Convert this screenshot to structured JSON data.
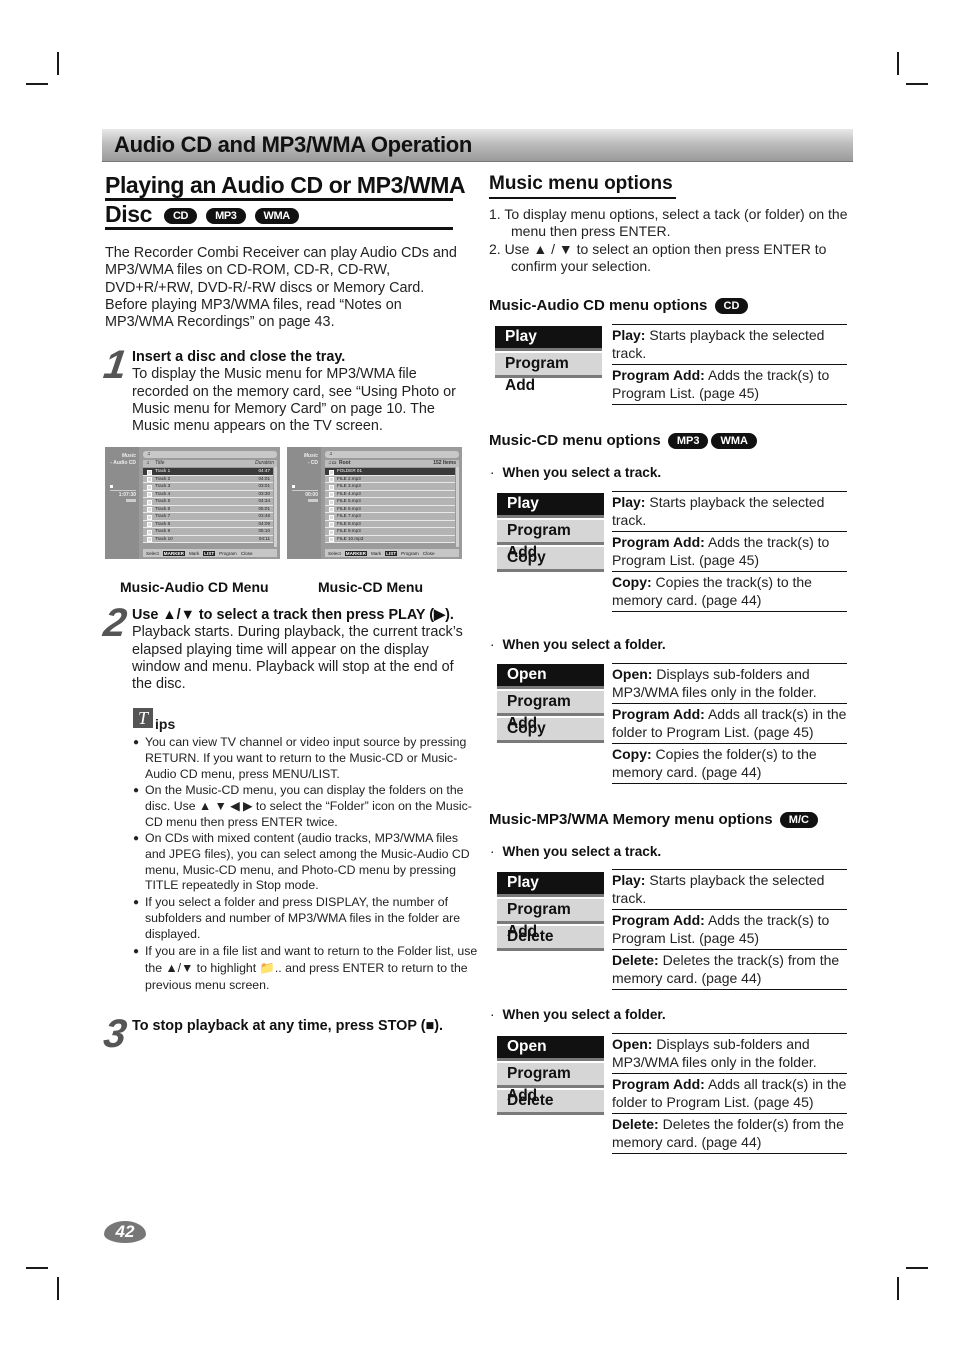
{
  "banner": "Audio CD and MP3/WMA Operation",
  "left": {
    "title_line1": "Playing an Audio CD or MP3/WMA",
    "title_line2": "Disc",
    "badges": [
      "CD",
      "MP3",
      "WMA"
    ],
    "intro": "The Recorder Combi Receiver can play Audio CDs and MP3/WMA files on CD-ROM, CD-R, CD-RW, DVD+R/+RW, DVD-R/-RW discs or Memory Card. Before playing MP3/WMA files, read “Notes on MP3/WMA Recordings” on page 43.",
    "step1": {
      "num": "1",
      "title": "Insert a disc and close the tray.",
      "body": "To display the Music menu for MP3/WMA file recorded on the memory card, see “Using Photo or Music menu for Memory Card” on page 10. The Music menu appears on the TV screen."
    },
    "screen_audio": {
      "side_title": "Music",
      "side_sub": "- Audio CD",
      "time": "1:07:30",
      "header_title": "Title",
      "header_duration": "Duration",
      "rows": [
        {
          "name": "Track 1",
          "dur": "04:47"
        },
        {
          "name": "Track 2",
          "dur": "04:01"
        },
        {
          "name": "Track 3",
          "dur": "03:01"
        },
        {
          "name": "Track 4",
          "dur": "03:30"
        },
        {
          "name": "Track 5",
          "dur": "04:34"
        },
        {
          "name": "Track 6",
          "dur": "05:01"
        },
        {
          "name": "Track 7",
          "dur": "03:48"
        },
        {
          "name": "Track 8",
          "dur": "04:09"
        },
        {
          "name": "Track 9",
          "dur": "05:10"
        },
        {
          "name": "Track 10",
          "dur": "04:11"
        }
      ],
      "footer": [
        "Select",
        "MARKER",
        "Mark",
        "LIST",
        "Program",
        "Close"
      ]
    },
    "screen_cd": {
      "side_title": "Music",
      "side_sub": "- CD",
      "time": "00:00",
      "header_title": "Root",
      "header_count": "152 Items",
      "rows": [
        "FOLDER 01",
        "FILE 2.mp3",
        "FILE 3.mp3",
        "FILE 4.mp3",
        "FILE 5.mp3",
        "FILE 6.mp3",
        "FILE 7.mp3",
        "FILE 8.mp3",
        "FILE 9.mp3",
        "FILE 10.mp3"
      ],
      "footer": [
        "Select",
        "MARKER",
        "Mark",
        "LIST",
        "Program",
        "Close"
      ]
    },
    "caption_audio": "Music-Audio CD Menu",
    "caption_cd": "Music-CD Menu",
    "step2": {
      "num": "2",
      "title": "Use ▲/▼ to select a track then press PLAY (▶).",
      "body": "Playback starts. During playback, the current track’s elapsed playing time will appear on the display window and menu. Playback will stop at the end of the disc."
    },
    "tips_icon": "T",
    "tips_label": "ips",
    "tips": [
      "You can view TV channel or video input source by pressing RETURN. If you want to return to the Music-CD or Music-Audio CD menu, press MENU/LIST.",
      "On the Music-CD menu, you can display the folders on the disc. Use ▲ ▼ ◀ ▶ to select the “Folder” icon on the Music-CD menu then press ENTER twice.",
      "On CDs with mixed content (audio tracks, MP3/WMA files and JPEG files), you can select among the Music-Audio CD menu, Music-CD menu, and Photo-CD menu by pressing TITLE repeatedly in Stop mode.",
      "If you select a folder and press DISPLAY, the number of subfolders and number of MP3/WMA files in the folder are displayed.",
      "If you are in a file list and want to return to the Folder list, use the ▲/▼ to highlight 📁.. and press ENTER to return to the previous menu screen."
    ],
    "step3": {
      "num": "3",
      "title": "To stop playback at any time, press STOP (■)."
    }
  },
  "right": {
    "title": "Music menu options",
    "instructions": [
      "1.  To display menu options, select a tack (or folder) on the menu then press ENTER.",
      "2.  Use ▲ / ▼ to select an option then press ENTER to confirm your selection."
    ],
    "sections": [
      {
        "title": "Music-Audio CD menu options",
        "badges": [
          "CD"
        ],
        "groups": [
          {
            "bullet": "",
            "menu": [
              "Play",
              "Program Add"
            ],
            "desc": [
              {
                "term": "Play:",
                "text": " Starts playback the selected track."
              },
              {
                "term": "Program Add:",
                "text": " Adds the track(s) to Program List. (page 45)"
              }
            ]
          }
        ]
      },
      {
        "title": "Music-CD menu options",
        "badges": [
          "MP3",
          "WMA"
        ],
        "groups": [
          {
            "bullet": "When you select a track.",
            "menu": [
              "Play",
              "Program Add",
              "Copy"
            ],
            "desc": [
              {
                "term": "Play:",
                "text": " Starts playback the selected track."
              },
              {
                "term": "Program Add:",
                "text": " Adds the track(s) to Program List. (page 45)"
              },
              {
                "term": "Copy:",
                "text": " Copies the track(s) to the memory card. (page 44)"
              }
            ]
          },
          {
            "bullet": "When you select a folder.",
            "menu": [
              "Open",
              "Program Add",
              "Copy"
            ],
            "desc": [
              {
                "term": "Open:",
                "text": " Displays sub-folders and MP3/WMA files only in the folder."
              },
              {
                "term": "Program Add:",
                "text": " Adds all track(s) in the folder to Program List. (page 45)"
              },
              {
                "term": "Copy:",
                "text": " Copies the folder(s) to the memory card. (page 44)"
              }
            ]
          }
        ]
      },
      {
        "title": "Music-MP3/WMA Memory menu options",
        "badges": [
          "M/C"
        ],
        "groups": [
          {
            "bullet": "When you select a track.",
            "menu": [
              "Play",
              "Program Add",
              "Delete"
            ],
            "desc": [
              {
                "term": "Play:",
                "text": " Starts playback the selected track."
              },
              {
                "term": "Program Add:",
                "text": " Adds the track(s) to Program List. (page 45)"
              },
              {
                "term": "Delete:",
                "text": " Deletes the track(s) from the memory card. (page 44)"
              }
            ]
          },
          {
            "bullet": "When you select a folder.",
            "menu": [
              "Open",
              "Program Add",
              "Delete"
            ],
            "desc": [
              {
                "term": "Open:",
                "text": " Displays sub-folders and MP3/WMA files only in the folder."
              },
              {
                "term": "Program Add:",
                "text": " Adds all track(s) in the folder to Program List. (page 45)"
              },
              {
                "term": "Delete:",
                "text": " Deletes the folder(s) from the memory card. (page 44)"
              }
            ]
          }
        ]
      }
    ]
  },
  "page_number": "42"
}
